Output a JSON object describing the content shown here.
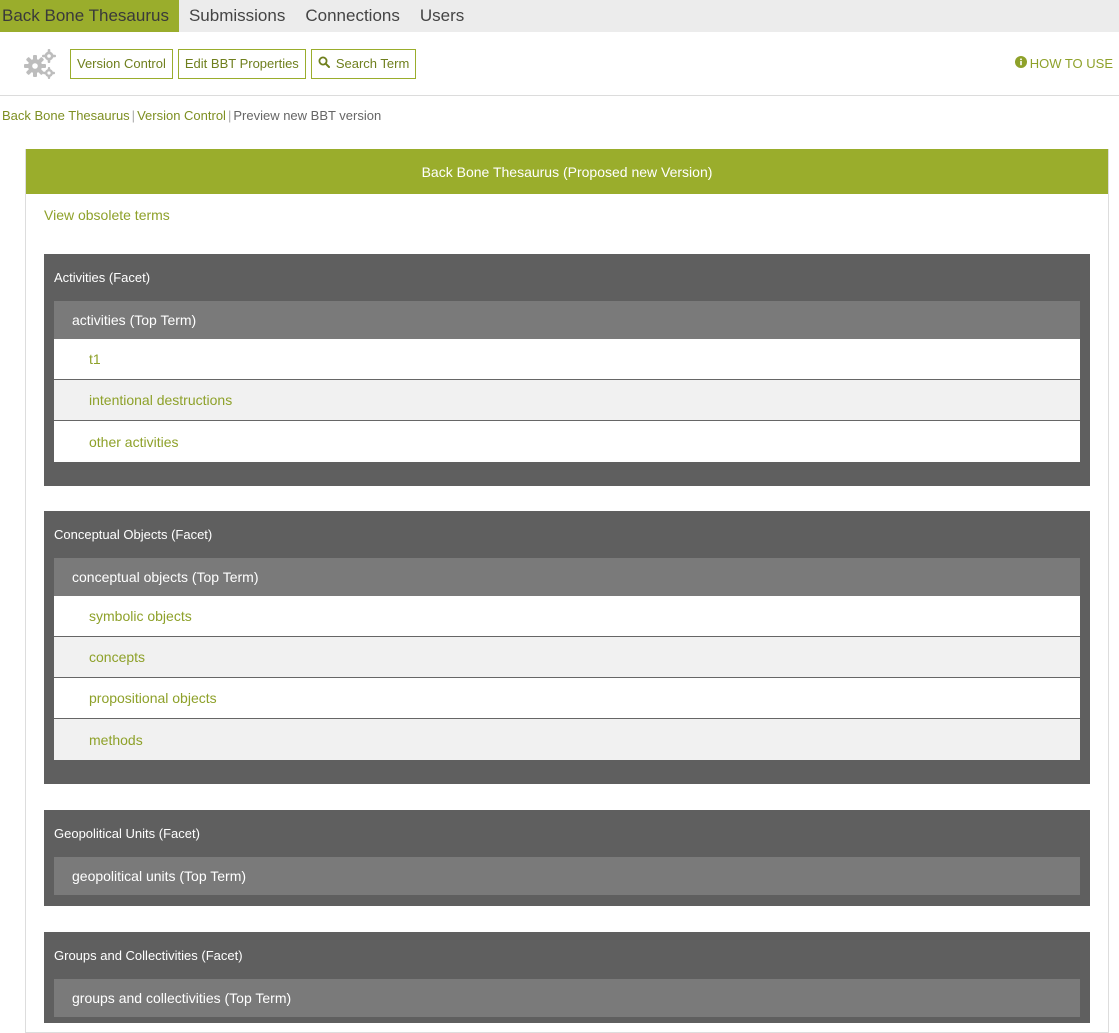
{
  "nav": {
    "tabs": [
      {
        "label": "Back Bone Thesaurus",
        "active": true
      },
      {
        "label": "Submissions",
        "active": false
      },
      {
        "label": "Connections",
        "active": false
      },
      {
        "label": "Users",
        "active": false
      }
    ]
  },
  "toolbar": {
    "version_control_label": "Version Control",
    "edit_properties_label": "Edit BBT Properties",
    "search_term_label": "Search Term",
    "how_to_use_label": "HOW TO USE"
  },
  "breadcrumb": {
    "items": [
      "Back Bone Thesaurus",
      "Version Control",
      "Preview new BBT version"
    ]
  },
  "panel": {
    "title": "Back Bone Thesaurus (Proposed new Version)",
    "obsolete_link": "View obsolete terms",
    "facets": [
      {
        "title": "Activities (Facet)",
        "top_term": "activities (Top Term)",
        "terms": [
          "t1",
          "intentional destructions",
          "other activities"
        ]
      },
      {
        "title": "Conceptual Objects (Facet)",
        "top_term": "conceptual objects (Top Term)",
        "terms": [
          "symbolic objects",
          "concepts",
          "propositional objects",
          "methods"
        ]
      },
      {
        "title": "Geopolitical Units (Facet)",
        "top_term": "geopolitical units (Top Term)",
        "terms": []
      },
      {
        "title": "Groups and Collectivities (Facet)",
        "top_term": "groups and collectivities (Top Term)",
        "terms": []
      }
    ]
  },
  "colors": {
    "accent": "#9aad2c",
    "link": "#8ea12a",
    "facet_bg": "#5f5f5f",
    "top_term_bg": "#7a7a7a"
  },
  "icons": {
    "settings": "gears-icon",
    "search": "search-icon",
    "info": "info-circle-icon"
  }
}
